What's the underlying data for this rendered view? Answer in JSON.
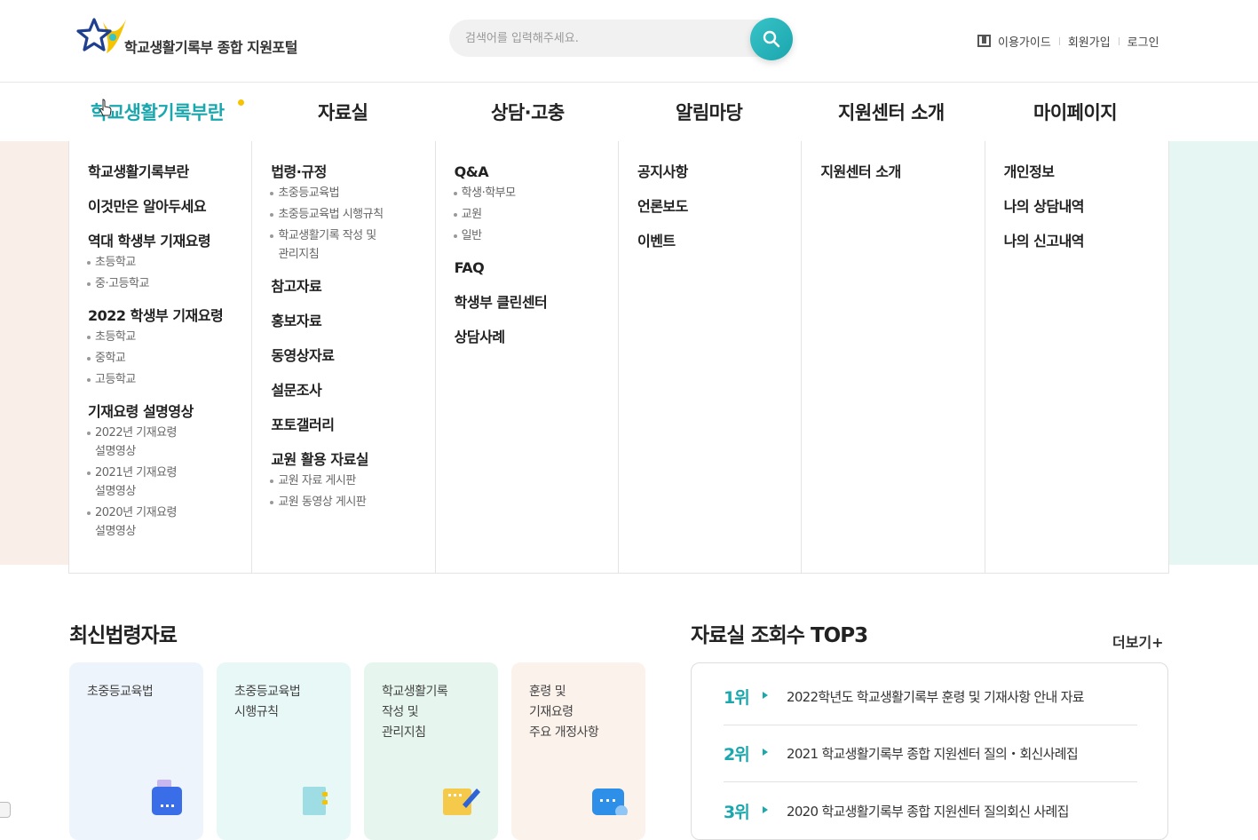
{
  "header": {
    "logo_text": "학교생활기록부 종합 지원포털",
    "search_placeholder": "검색어를 입력해주세요.",
    "util_links": [
      "이용가이드",
      "회원가입",
      "로그인"
    ]
  },
  "gnb": {
    "items": [
      "학교생활기록부란",
      "자료실",
      "상담·고충",
      "알림마당",
      "지원센터 소개",
      "마이페이지"
    ],
    "active_index": 0
  },
  "mega_menu": {
    "col1": {
      "a": "학교생활기록부란",
      "b": "이것만은 알아두세요",
      "c": "역대 학생부 기재요령",
      "c_subs": [
        "초등학교",
        "중·고등학교"
      ],
      "d": "2022 학생부 기재요령",
      "d_subs": [
        "초등학교",
        "중학교",
        "고등학교"
      ],
      "e": "기재요령 설명영상",
      "e_subs": [
        "2022년 기재요령\n설명영상",
        "2021년 기재요령\n설명영상",
        "2020년 기재요령\n설명영상"
      ]
    },
    "col2": {
      "a": "법령·규정",
      "a_subs": [
        "초중등교육법",
        "초중등교육법 시행규칙",
        "학교생활기록 작성 및\n관리지침"
      ],
      "b": "참고자료",
      "c": "홍보자료",
      "d": "동영상자료",
      "e": "설문조사",
      "f": "포토갤러리",
      "g": "교원 활용 자료실",
      "g_subs": [
        "교원 자료 게시판",
        "교원 동영상 게시판"
      ]
    },
    "col3": {
      "a": "Q&A",
      "a_subs": [
        "학생·학부모",
        "교원",
        "일반"
      ],
      "b": "FAQ",
      "c": "학생부 클린센터",
      "d": "상담사례"
    },
    "col4": {
      "a": "공지사항",
      "b": "언론보도",
      "c": "이벤트"
    },
    "col5": {
      "a": "지원센터 소개"
    },
    "col6": {
      "a": "개인정보",
      "b": "나의 상담내역",
      "c": "나의 신고내역"
    }
  },
  "latest_law": {
    "title": "최신법령자료",
    "cards": [
      {
        "text": "초중등교육법",
        "color": "#eef4fb"
      },
      {
        "text": "초중등교육법\n시행규칙",
        "color": "#e8f8f7"
      },
      {
        "text": "학교생활기록\n작성 및\n관리지침",
        "color": "#e6f6ee"
      },
      {
        "text": "훈령 및\n기재요령\n주요 개정사항",
        "color": "#fcf2ec"
      }
    ]
  },
  "top3": {
    "title": "자료실 조회수 TOP3",
    "more": "더보기+",
    "rows": [
      {
        "rank": "1위",
        "text": "2022학년도 학교생활기록부 훈령 및 기재사항 안내 자료"
      },
      {
        "rank": "2위",
        "text": "2021 학교생활기록부 종합 지원센터 질의・회신사례집"
      },
      {
        "rank": "3위",
        "text": "2020 학교생활기록부 종합 지원센터 질의회신 사례집"
      }
    ]
  },
  "colors": {
    "accent": "#1aa7ad",
    "star_yellow": "#f5c300",
    "star_navy": "#1f3f8f"
  }
}
